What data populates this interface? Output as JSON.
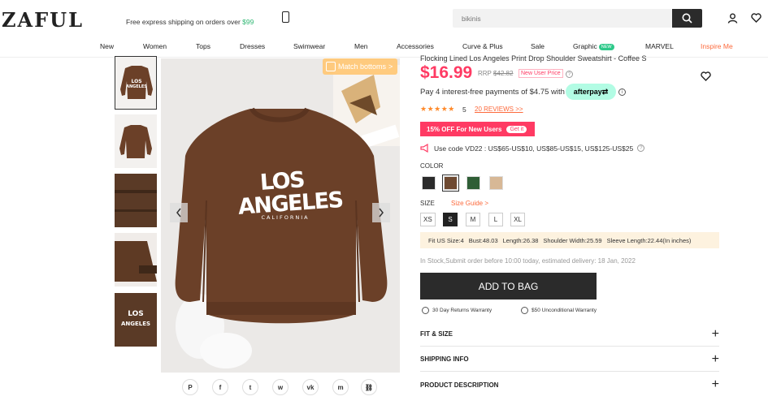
{
  "header": {
    "logo": "ZAFUL",
    "shipping_text": "Free express shipping on orders over",
    "shipping_amount": "$99",
    "search_placeholder": "bikinis"
  },
  "nav": {
    "items": [
      "New",
      "Women",
      "Tops",
      "Dresses",
      "Swimwear",
      "Men",
      "Accessories",
      "Curve & Plus",
      "Sale",
      "Graphic",
      "MARVEL",
      "Inspire Me"
    ],
    "graphic_badge": "NEW",
    "highlight_color": "#fc6a3c"
  },
  "gallery": {
    "match_label": "Match bottoms",
    "match_arrow": ">",
    "print_main": "LOS ANGELES",
    "print_sub": "CALIFORNIA",
    "share_icons": [
      "pinterest-icon",
      "facebook-icon",
      "twitter-icon",
      "whatsapp-icon",
      "vk-icon",
      "messenger-icon",
      "link-icon"
    ],
    "share_glyphs": [
      "P",
      "f",
      "t",
      "w",
      "vk",
      "m",
      "⛓"
    ]
  },
  "product": {
    "title": "Flocking Lined Los Angeles Print Drop Shoulder Sweatshirt - Coffee S",
    "price": "$16.99",
    "rrp_label": "RRP",
    "rrp_value": "$42.82",
    "new_user_price": "New User Price",
    "afterpay_text": "Pay 4 interest-free payments of $4.75 with",
    "afterpay_logo": "afterpay⇄",
    "stars": "★★★★★",
    "rating": "5",
    "reviews": "20 REVIEWS >>",
    "promo": "15% OFF For New Users",
    "promo_cta": "Get it",
    "code_text": "Use code VD22 : US$65-US$10, US$85-US$15, US$125-US$25",
    "color_label": "COLOR",
    "colors": [
      "#2b2b2b",
      "#6e4a32",
      "#2f5e36",
      "#d7b896"
    ],
    "size_label": "SIZE",
    "size_guide": "Size Guide >",
    "sizes": [
      "XS",
      "S",
      "M",
      "L",
      "XL"
    ],
    "selected_size": "S",
    "fit": [
      "Fit US Size:4",
      "Bust:48.03",
      "Length:26.38",
      "Shoulder Width:25.59",
      "Sleeve Length:22.44(In inches)"
    ],
    "stock": "In Stock,Submit order before 10:00 today, estimated delivery: 18 Jan, 2022",
    "add_to_bag": "ADD TO BAG",
    "returns": "30 Day Returns Warranty",
    "guarantee": "$50 Unconditional Warranty",
    "sections": [
      "FIT & SIZE",
      "SHIPPING INFO",
      "PRODUCT DESCRIPTION"
    ]
  }
}
